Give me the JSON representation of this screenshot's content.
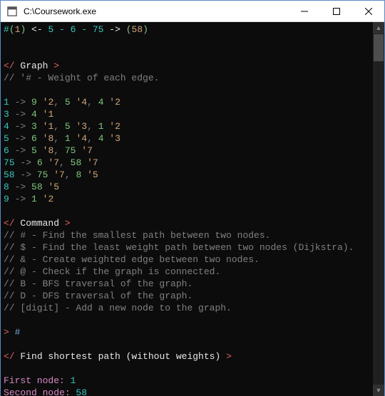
{
  "window": {
    "title": "C:\\Coursework.exe"
  },
  "top_status": {
    "hash": "#",
    "left_paren_l": "(",
    "one": "1",
    "left_paren_r": ")",
    "arrow_l": " <- ",
    "seq": "5 - 6 - 75",
    "arrow_r": " -> ",
    "right_paren_l": "(",
    "fiftyeight": "58",
    "right_paren_r": ")"
  },
  "graph": {
    "open": "</",
    "label": " Graph ",
    "close": ">",
    "comment": "// '# - Weight of each edge.",
    "edges": [
      {
        "src": "1",
        "arrow": " -> ",
        "targets": [
          [
            "9",
            "'2"
          ],
          [
            "5",
            "'4"
          ],
          [
            "4",
            "'2"
          ]
        ]
      },
      {
        "src": "3",
        "arrow": " -> ",
        "targets": [
          [
            "4",
            "'1"
          ]
        ]
      },
      {
        "src": "4",
        "arrow": " -> ",
        "targets": [
          [
            "3",
            "'1"
          ],
          [
            "5",
            "'3"
          ],
          [
            "1",
            "'2"
          ]
        ]
      },
      {
        "src": "5",
        "arrow": " -> ",
        "targets": [
          [
            "6",
            "'8"
          ],
          [
            "1",
            "'4"
          ],
          [
            "4",
            "'3"
          ]
        ]
      },
      {
        "src": "6",
        "arrow": " -> ",
        "targets": [
          [
            "5",
            "'8"
          ],
          [
            "75",
            "'7"
          ]
        ]
      },
      {
        "src": "75",
        "arrow": " -> ",
        "targets": [
          [
            "6",
            "'7"
          ],
          [
            "58",
            "'7"
          ]
        ]
      },
      {
        "src": "58",
        "arrow": " -> ",
        "targets": [
          [
            "75",
            "'7"
          ],
          [
            "8",
            "'5"
          ]
        ]
      },
      {
        "src": "8",
        "arrow": " -> ",
        "targets": [
          [
            "58",
            "'5"
          ]
        ]
      },
      {
        "src": "9",
        "arrow": " -> ",
        "targets": [
          [
            "1",
            "'2"
          ]
        ]
      }
    ]
  },
  "command": {
    "open": "</",
    "label": " Command ",
    "close": ">",
    "lines": [
      "// # - Find the smallest path between two nodes.",
      "// $ - Find the least weight path between two nodes (Dijkstra).",
      "// & - Create weighted edge between two nodes.",
      "// @ - Check if the graph is connected.",
      "// B - BFS traversal of the graph.",
      "// D - DFS traversal of the graph.",
      "// [digit] - Add a new node to the graph."
    ]
  },
  "prompt": {
    "caret": "> ",
    "input": "#"
  },
  "shortest": {
    "open": "</",
    "label": " Find shortest path (without weights) ",
    "close": ">",
    "first_lbl": "First node: ",
    "first_val": "1",
    "second_lbl": "Second node: ",
    "second_val": "58"
  },
  "scroll": {
    "up": "▲",
    "down": "▼"
  }
}
